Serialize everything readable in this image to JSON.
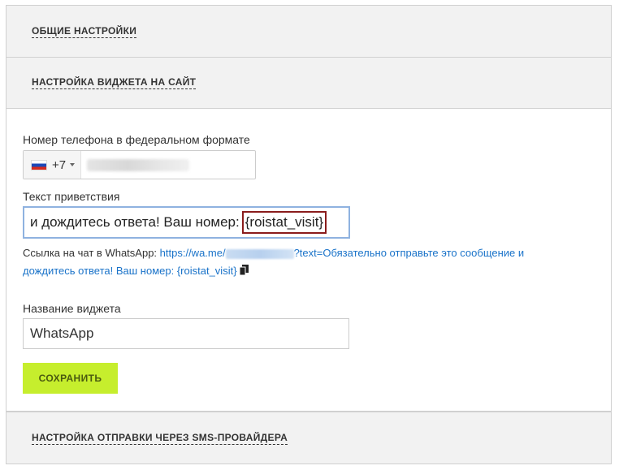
{
  "sections": {
    "general": "ОБЩИЕ НАСТРОЙКИ",
    "widget_site": "НАСТРОЙКА ВИДЖЕТА НА САЙТ",
    "sms": "НАСТРОЙКА ОТПРАВКИ ЧЕРЕЗ SMS-ПРОВАЙДЕРА"
  },
  "form": {
    "phone_label": "Номер телефона в федеральном формате",
    "country_code": "+7",
    "greeting_label": "Текст приветствия",
    "greeting_value_prefix": "и дождитесь ответа! Ваш номер: ",
    "greeting_value_token": "{roistat_visit}",
    "link_prefix": "Ссылка на чат в WhatsApp: ",
    "link_url_start": "https://wa.me/",
    "link_url_rest_line1": "?text=Обязательно отправьте это сообщение и",
    "link_url_line2": "дождитесь ответа! Ваш номер: {roistat_visit}",
    "widget_name_label": "Название виджета",
    "widget_name_value": "WhatsApp",
    "save_label": "СОХРАНИТЬ"
  },
  "colors": {
    "accent_button": "#c6ee2d",
    "link": "#1a73c9",
    "highlight_border": "#8a1c1c",
    "focus_border": "#8fb2e0"
  },
  "icons": {
    "flag": "russia-flag-icon",
    "copy": "copy-icon"
  }
}
